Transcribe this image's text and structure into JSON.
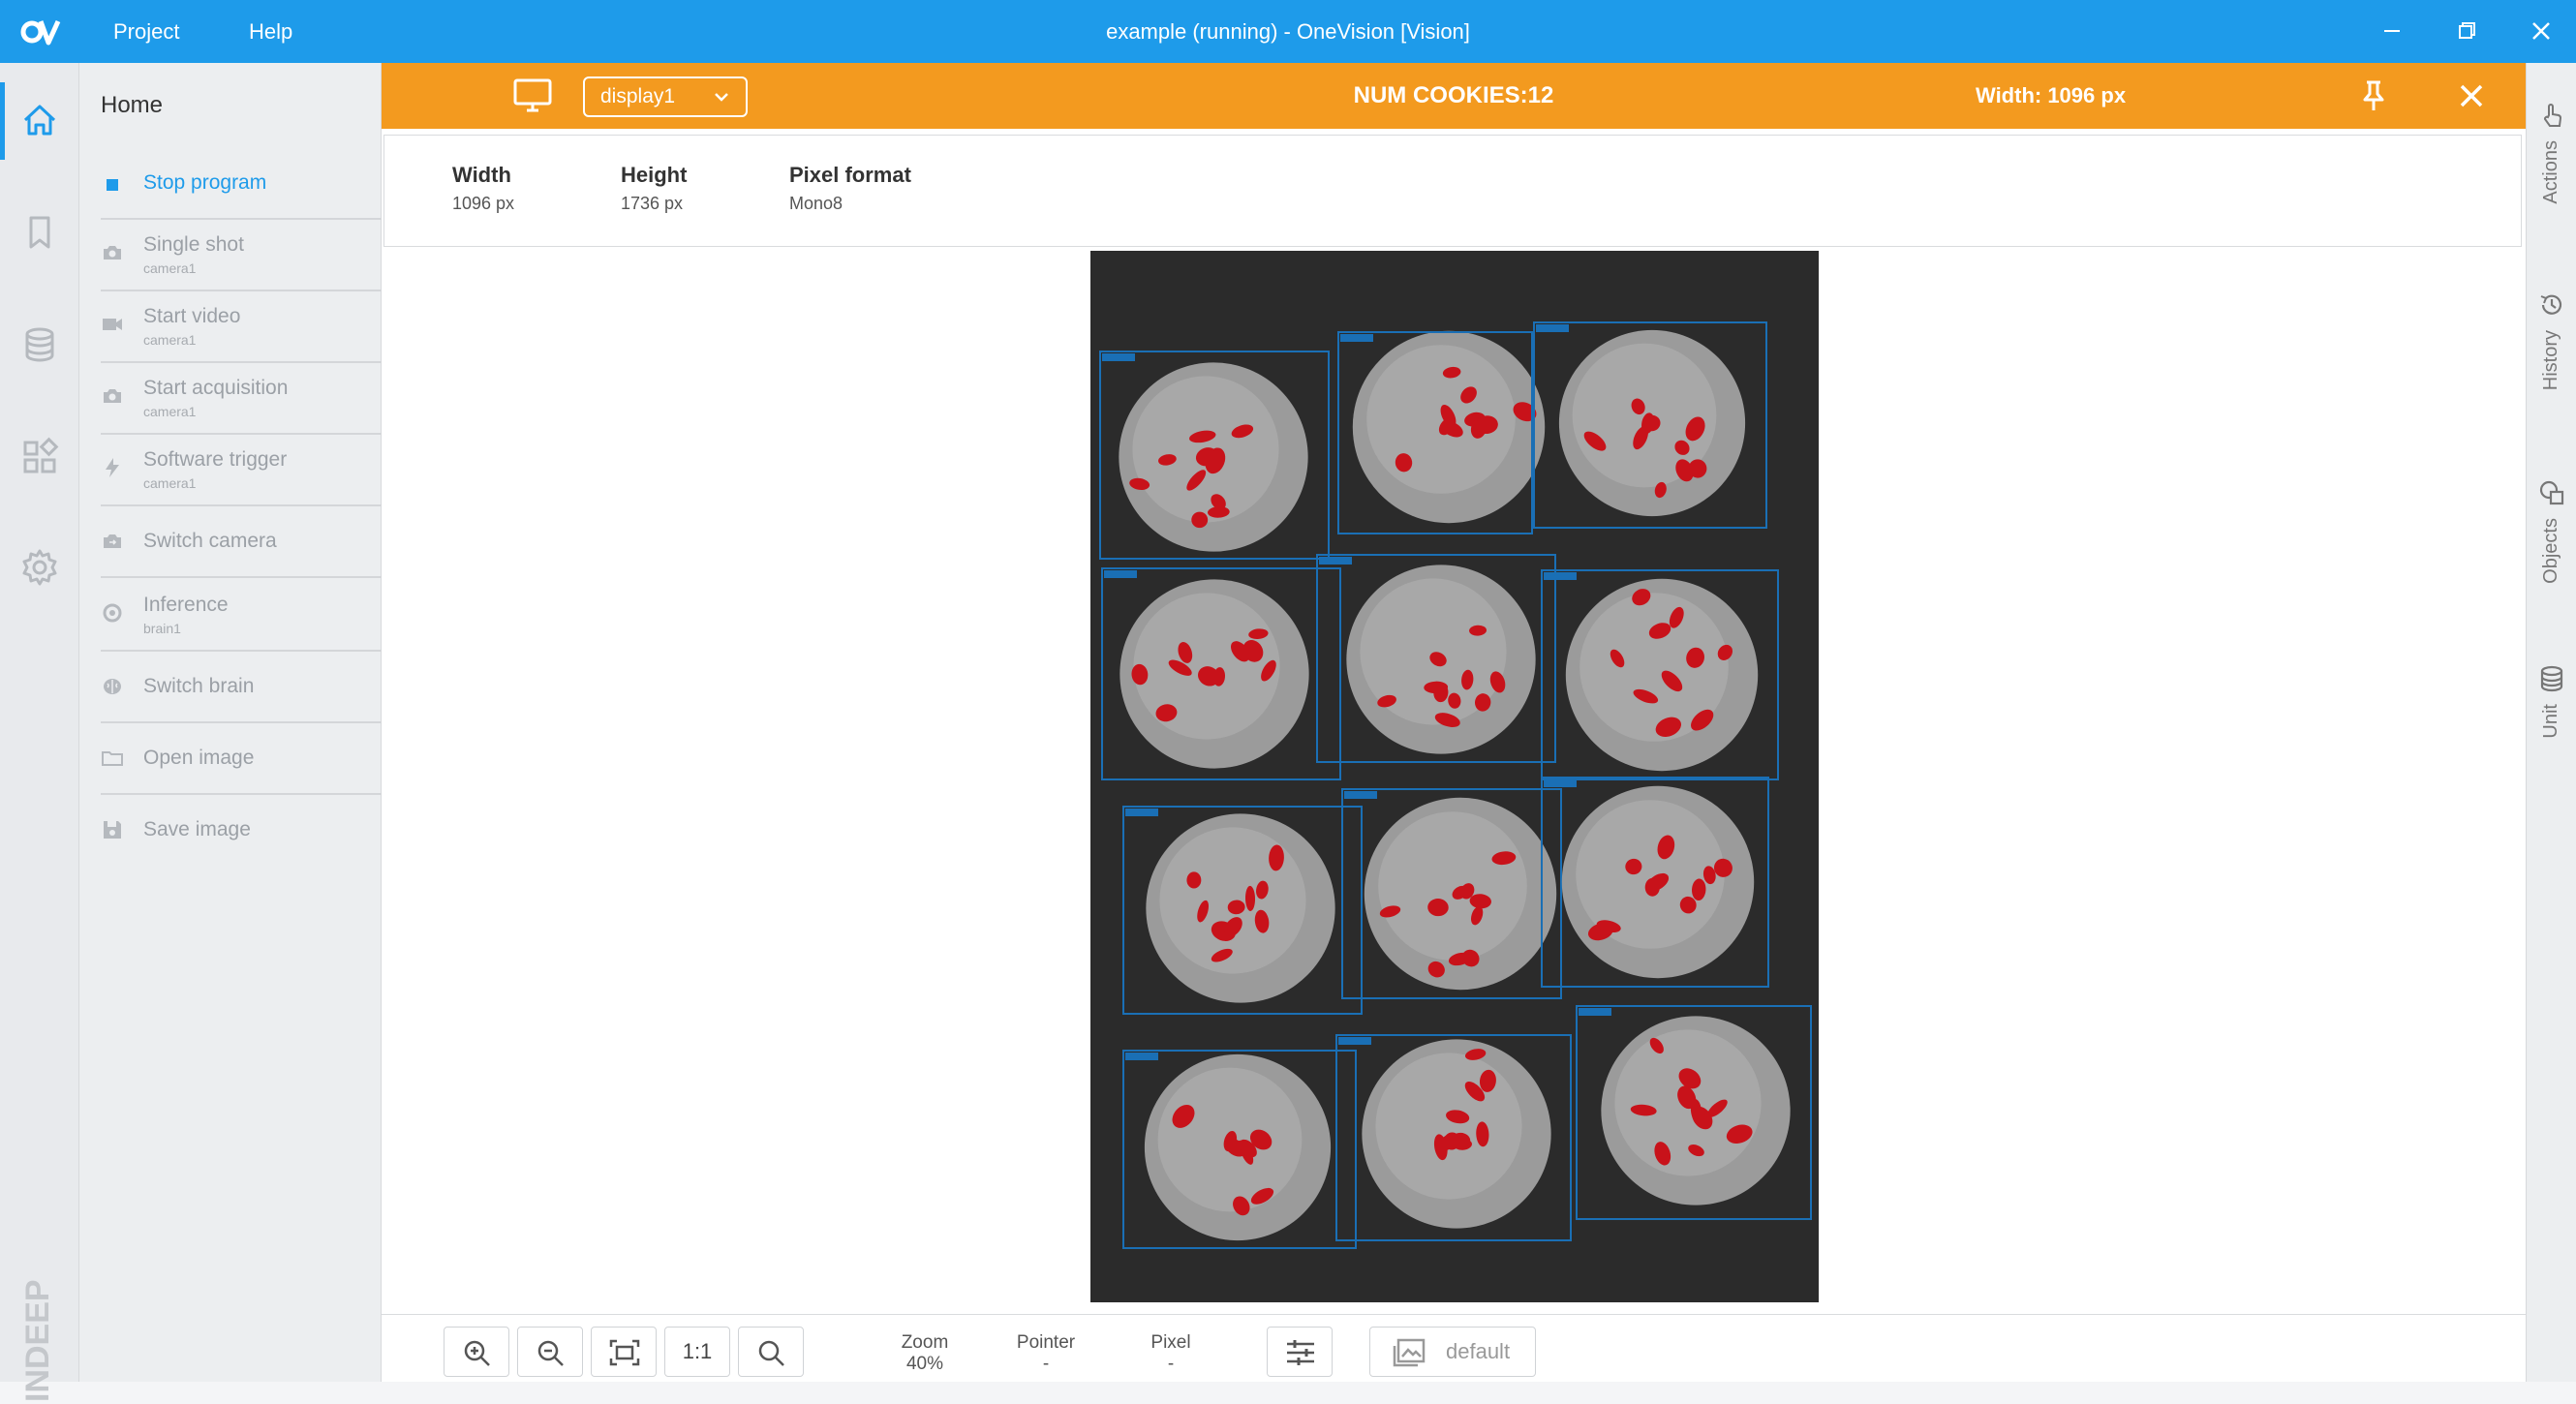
{
  "titlebar": {
    "menu": [
      "Project",
      "Help"
    ],
    "title": "example (running)  -  OneVision [Vision]"
  },
  "sidebar": {
    "title": "Home",
    "actions": [
      {
        "label": "Stop program",
        "sub": ""
      },
      {
        "label": "Single shot",
        "sub": "camera1"
      },
      {
        "label": "Start video",
        "sub": "camera1"
      },
      {
        "label": "Start acquisition",
        "sub": "camera1"
      },
      {
        "label": "Software trigger",
        "sub": "camera1"
      },
      {
        "label": "Switch camera",
        "sub": ""
      },
      {
        "label": "Inference",
        "sub": "brain1"
      },
      {
        "label": "Switch brain",
        "sub": ""
      },
      {
        "label": "Open image",
        "sub": ""
      },
      {
        "label": "Save image",
        "sub": ""
      }
    ]
  },
  "display": {
    "selected": "display1",
    "center_text": "NUM COOKIES:12",
    "width_text": "Width:  1096 px"
  },
  "image_info": {
    "width": {
      "label": "Width",
      "value": "1096 px"
    },
    "height": {
      "label": "Height",
      "value": "1736 px"
    },
    "format": {
      "label": "Pixel format",
      "value": "Mono8"
    }
  },
  "viewer": {
    "cookie_count": 12
  },
  "toolbar": {
    "one_to_one": "1:1",
    "zoom_label": "Zoom",
    "zoom_value": "40%",
    "pointer_label": "Pointer",
    "pointer_value": "-",
    "pixel_label": "Pixel",
    "pixel_value": "-",
    "palette": "default"
  },
  "right_tabs": [
    "Actions",
    "History",
    "Objects",
    "Unit"
  ],
  "colors": {
    "titlebar": "#1e9bea",
    "accent": "#1e9bea",
    "display_bar": "#f39a1f",
    "detection_box": "#1a6fb5",
    "defect": "#c8121a"
  },
  "brand_logo": "INDEEP"
}
